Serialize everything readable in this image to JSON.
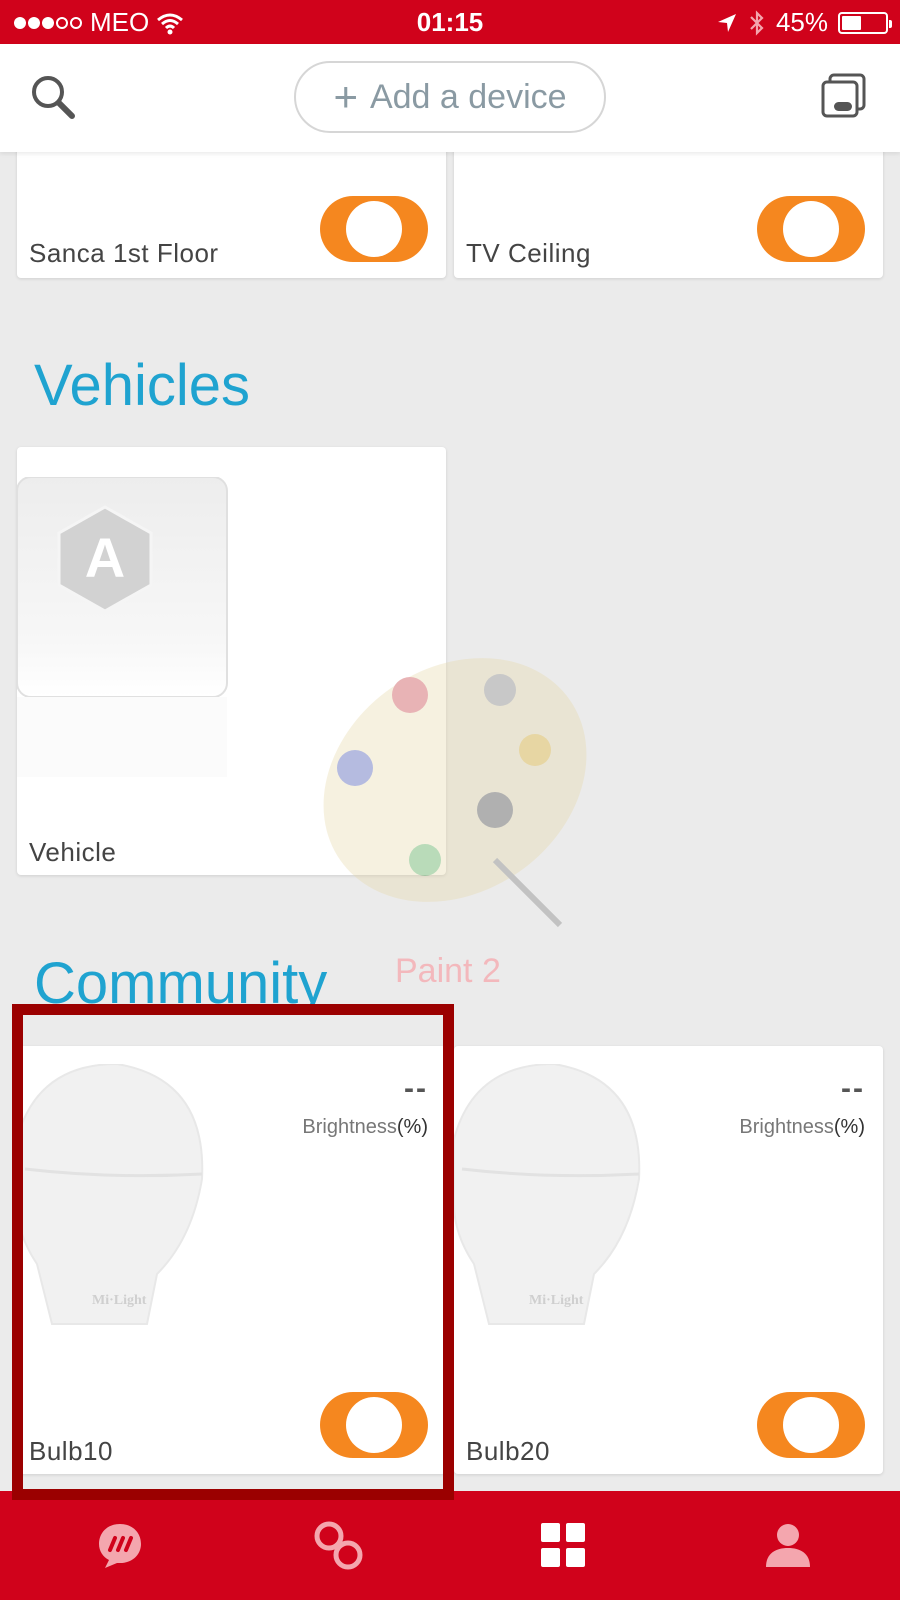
{
  "status_bar": {
    "carrier": "MEO",
    "time": "01:15",
    "battery_percent": "45%",
    "battery_level": 0.45
  },
  "header": {
    "search_icon": "search-icon",
    "add_device_label": "Add a device",
    "switch_view_icon": "card-switch-icon"
  },
  "rooms": [
    {
      "name": "Sanca 1st Floor",
      "toggle_on": true
    },
    {
      "name": "TV Ceiling",
      "toggle_on": true
    }
  ],
  "sections": {
    "vehicles_title": "Vehicles",
    "community_title": "Community"
  },
  "vehicles": [
    {
      "name": "Vehicle",
      "logo_letter": "A"
    }
  ],
  "watermark": {
    "label": "Paint 2"
  },
  "community_devices": [
    {
      "name": "Bulb10",
      "brightness_value": "--",
      "brightness_label": "Brightness",
      "brightness_unit": "(%)",
      "bulb_brand": "Mi·Light",
      "toggle_on": true
    },
    {
      "name": "Bulb20",
      "brightness_value": "--",
      "brightness_label": "Brightness",
      "brightness_unit": "(%)",
      "bulb_brand": "Mi·Light",
      "toggle_on": true
    }
  ],
  "tab_bar": {
    "tabs": [
      {
        "icon": "chat-icon"
      },
      {
        "icon": "scenes-icon"
      },
      {
        "icon": "devices-grid-icon",
        "active": true
      },
      {
        "icon": "profile-icon"
      }
    ]
  },
  "colors": {
    "brand_red": "#d0021b",
    "toggle_orange": "#f5871f",
    "section_blue": "#1fa3d0",
    "highlight_border": "#9b0000"
  }
}
